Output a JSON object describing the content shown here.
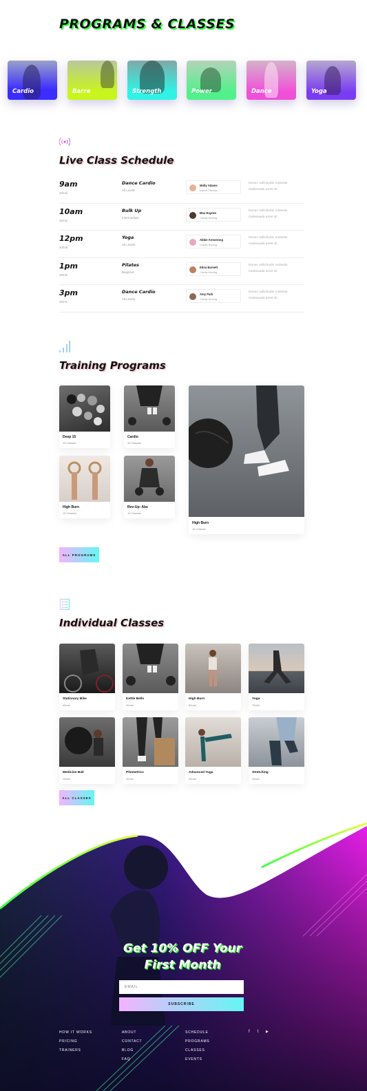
{
  "header": {
    "title": "PROGRAMS & CLASSES"
  },
  "categories": [
    {
      "label": "Cardio",
      "color": "#3b2cff"
    },
    {
      "label": "Barre",
      "color": "#c8f51c"
    },
    {
      "label": "Strength",
      "color": "#2ff3e6"
    },
    {
      "label": "Power",
      "color": "#52f08a"
    },
    {
      "label": "Dance",
      "color": "#f04fd8"
    },
    {
      "label": "Yoga",
      "color": "#7a3cf2"
    }
  ],
  "schedule": {
    "title": "Live Class Schedule",
    "icon": "broadcast-icon",
    "rows": [
      {
        "time": "9am",
        "duration": "20min",
        "class": "Dance Cardio",
        "level": "All Levels",
        "trainer": "Molly Adams",
        "role": "Dance Fitness",
        "desc": "Donec sollicitudin molestie malesuada amet sit"
      },
      {
        "time": "10am",
        "duration": "45min",
        "class": "Bulk Up",
        "level": "Intermediate",
        "trainer": "Max Haynes",
        "role": "Cardio Boxing",
        "desc": "Donec sollicitudin molestie malesuada amet sit"
      },
      {
        "time": "12pm",
        "duration": "30min",
        "class": "Yoga",
        "level": "All Levels",
        "trainer": "Abbie Armstrong",
        "role": "Cardio Boxing",
        "desc": "Donec sollicitudin molestie malesuada amet sit"
      },
      {
        "time": "1pm",
        "duration": "20min",
        "class": "Pilates",
        "level": "Beginner",
        "trainer": "Edna Barnett",
        "role": "Cardio Boxing",
        "desc": "Donec sollicitudin molestie malesuada amet sit"
      },
      {
        "time": "3pm",
        "duration": "40min",
        "class": "Dance Cardio",
        "level": "All Levels",
        "trainer": "Amy Park",
        "role": "Cardio Boxing",
        "desc": "Donec sollicitudin molestie malesuada amet sit"
      }
    ]
  },
  "training": {
    "title": "Training Programs",
    "icon": "signal-bars-icon",
    "programs": [
      {
        "name": "Deep 15",
        "count": "15 Classes"
      },
      {
        "name": "Cardio",
        "count": "15 Classes"
      },
      {
        "name": "High Burn",
        "count": "15 Classes"
      },
      {
        "name": "Rev-Up: Abs",
        "count": "15 Classes"
      },
      {
        "name": "High Burn",
        "count": "15 Classes"
      }
    ],
    "button": "ALL PROGRAMS"
  },
  "classes": {
    "title": "Individual Classes",
    "icon": "checklist-icon",
    "items": [
      {
        "name": "Stationary Bike",
        "duration": "45min"
      },
      {
        "name": "Kettle Bells",
        "duration": "20min"
      },
      {
        "name": "High Burn",
        "duration": "60min"
      },
      {
        "name": "Yoga",
        "duration": "75min"
      },
      {
        "name": "Medicine Ball",
        "duration": "15min"
      },
      {
        "name": "Pilometrics",
        "duration": "30min"
      },
      {
        "name": "Advanced Yoga",
        "duration": "25min"
      },
      {
        "name": "Stretching",
        "duration": "15min"
      }
    ],
    "button": "ALL CLASSES"
  },
  "promo": {
    "title_line1": "Get 10% OFF Your",
    "title_line2": "First Month",
    "email_placeholder": "EMAIL",
    "subscribe": "SUBSCRIBE"
  },
  "footer": {
    "col1": [
      "HOW IT WORKS",
      "PRICING",
      "TRAINERS"
    ],
    "col2": [
      "ABOUT",
      "CONTACT",
      "BLOG",
      "FAQ"
    ],
    "col3": [
      "SCHEDULE",
      "PROGRAMS",
      "CLASSES",
      "EVENTS"
    ],
    "social": {
      "facebook": "f",
      "twitter": "t",
      "youtube": "▶"
    }
  }
}
